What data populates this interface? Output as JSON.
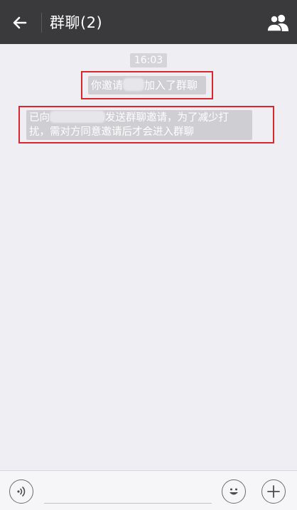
{
  "header": {
    "title": "群聊(2)",
    "back_icon": "arrow-left-icon",
    "members_icon": "group-members-icon"
  },
  "chat": {
    "time": "16:03",
    "messages": [
      {
        "parts": [
          "你邀请",
          "加入了群聊"
        ]
      },
      {
        "line1_parts": [
          "已向",
          "发送群聊邀请，为了减少打"
        ],
        "line2": "扰，需对方同意邀请后才会进入群聊"
      }
    ]
  },
  "input_bar": {
    "voice_icon": "voice-icon",
    "text_value": "",
    "emoji_icon": "emoji-icon",
    "plus_icon": "plus-icon"
  },
  "colors": {
    "header_bg": "#3a3a3c",
    "chat_bg": "#efeef3",
    "system_bubble": "#cfced3",
    "highlight_border": "#d8282e"
  }
}
